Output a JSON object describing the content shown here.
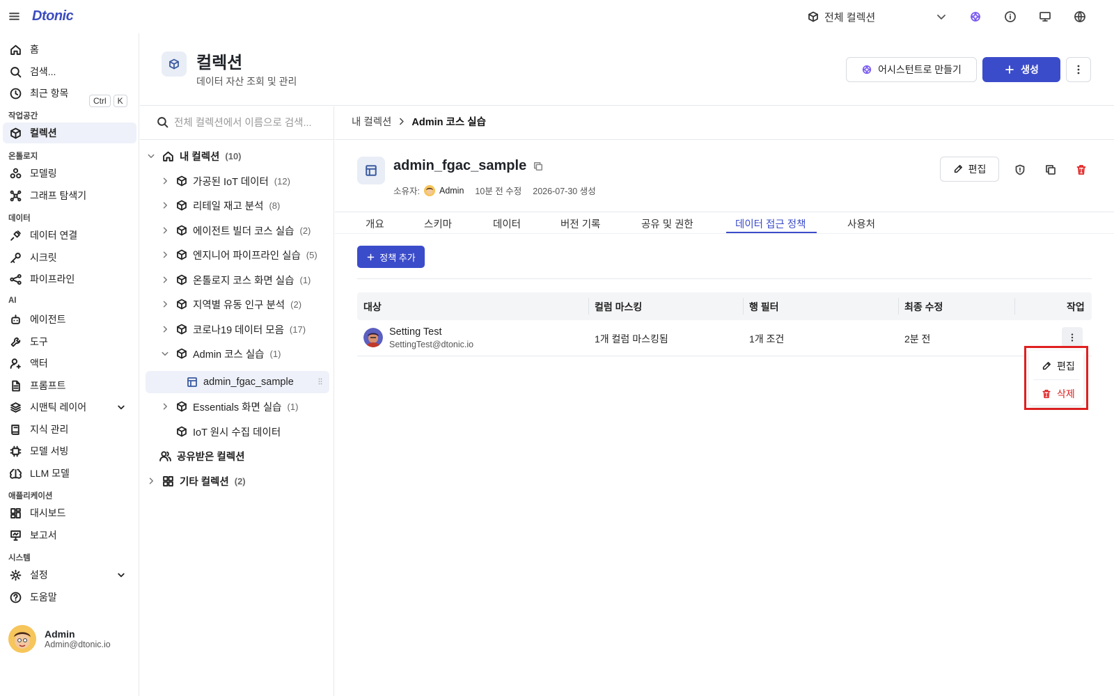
{
  "app": {
    "logo": "Dtonic",
    "collection_scope": "전체 컬렉션"
  },
  "colors": {
    "accent": "#3b4cca",
    "danger": "#e02020",
    "selected_bg": "#eef1f9"
  },
  "nav": {
    "home": "홈",
    "search": "검색...",
    "search_kbd": [
      "Ctrl",
      "K"
    ],
    "recent": "최근 항목",
    "sections": {
      "workspace": "작업공간",
      "ontology": "온톨로지",
      "data": "데이터",
      "ai": "AI",
      "apps": "애플리케이션",
      "system": "시스템"
    },
    "collection": "컬렉션",
    "modeling": "모델링",
    "graph_explorer": "그래프 탐색기",
    "data_connection": "데이터 연결",
    "secret": "시크릿",
    "pipeline": "파이프라인",
    "agent": "에이전트",
    "tool": "도구",
    "actor": "액터",
    "prompt": "프롬프트",
    "semantic_layer": "시맨틱 레이어",
    "knowledge": "지식 관리",
    "model_serving": "모델 서빙",
    "llm_model": "LLM 모델",
    "dashboard": "대시보드",
    "report": "보고서",
    "settings": "설정",
    "help": "도움말"
  },
  "user": {
    "name": "Admin",
    "email": "Admin@dtonic.io"
  },
  "header": {
    "title": "컬렉션",
    "subtitle": "데이터 자산 조회 및 관리",
    "assistant_button": "어시스턴트로 만들기",
    "create_button": "생성"
  },
  "tree": {
    "search_placeholder": "전체 컬렉션에서 이름으로 검색...",
    "my_collections": {
      "label": "내 컬렉션",
      "count": "(10)"
    },
    "items": [
      {
        "label": "가공된 IoT 데이터",
        "count": "(12)"
      },
      {
        "label": "리테일 재고 분석",
        "count": "(8)"
      },
      {
        "label": "에이전트 빌더 코스 실습",
        "count": "(2)"
      },
      {
        "label": "엔지니어 파이프라인 실습",
        "count": "(5)"
      },
      {
        "label": "온톨로지 코스 화면 실습",
        "count": "(1)"
      },
      {
        "label": "지역별 유동 인구 분석",
        "count": "(2)"
      },
      {
        "label": "코로나19 데이터 모음",
        "count": "(17)"
      },
      {
        "label": "Admin 코스 실습",
        "count": "(1)"
      },
      {
        "label": "admin_fgac_sample",
        "count": ""
      },
      {
        "label": "Essentials 화면 실습",
        "count": "(1)"
      },
      {
        "label": "IoT 원시 수집 데이터",
        "count": ""
      }
    ],
    "shared": "공유받은 컬렉션",
    "other": {
      "label": "기타 컬렉션",
      "count": "(2)"
    }
  },
  "breadcrumb": {
    "parent": "내 컬렉션",
    "current": "Admin 코스 실습"
  },
  "dataset": {
    "name": "admin_fgac_sample",
    "owner_label": "소유자:",
    "owner": "Admin",
    "modified": "10분 전 수정",
    "created": "2026-07-30 생성",
    "edit_button": "편집"
  },
  "tabs": [
    "개요",
    "스키마",
    "데이터",
    "버전 기록",
    "공유 및 권한",
    "데이터 접근 정책",
    "사용처"
  ],
  "active_tab": "데이터 접근 정책",
  "policy": {
    "add_button": "정책 추가",
    "columns": [
      "대상",
      "컬럼 마스킹",
      "행 필터",
      "최종 수정",
      "작업"
    ],
    "rows": [
      {
        "name": "Setting Test",
        "email": "SettingTest@dtonic.io",
        "masking": "1개 컬럼 마스킹됨",
        "filter": "1개 조건",
        "modified": "2분 전"
      }
    ]
  },
  "context_menu": {
    "edit": "편집",
    "delete": "삭제"
  }
}
